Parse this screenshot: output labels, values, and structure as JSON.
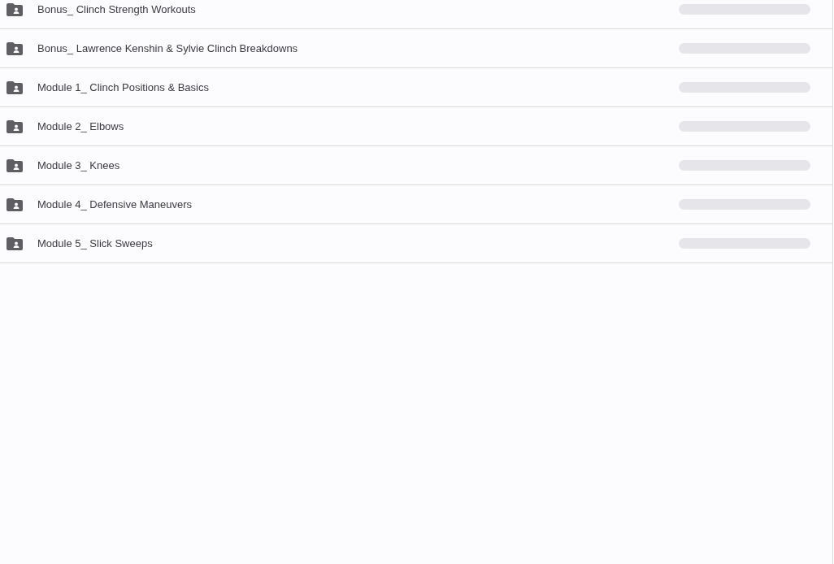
{
  "folders": [
    {
      "name": "Bonus_ Clinch Strength Workouts"
    },
    {
      "name": "Bonus_ Lawrence Kenshin & Sylvie Clinch Breakdowns"
    },
    {
      "name": "Module 1_ Clinch Positions & Basics"
    },
    {
      "name": "Module 2_ Elbows"
    },
    {
      "name": "Module 3_ Knees"
    },
    {
      "name": "Module 4_ Defensive Maneuvers"
    },
    {
      "name": "Module 5_ Slick Sweeps"
    }
  ]
}
